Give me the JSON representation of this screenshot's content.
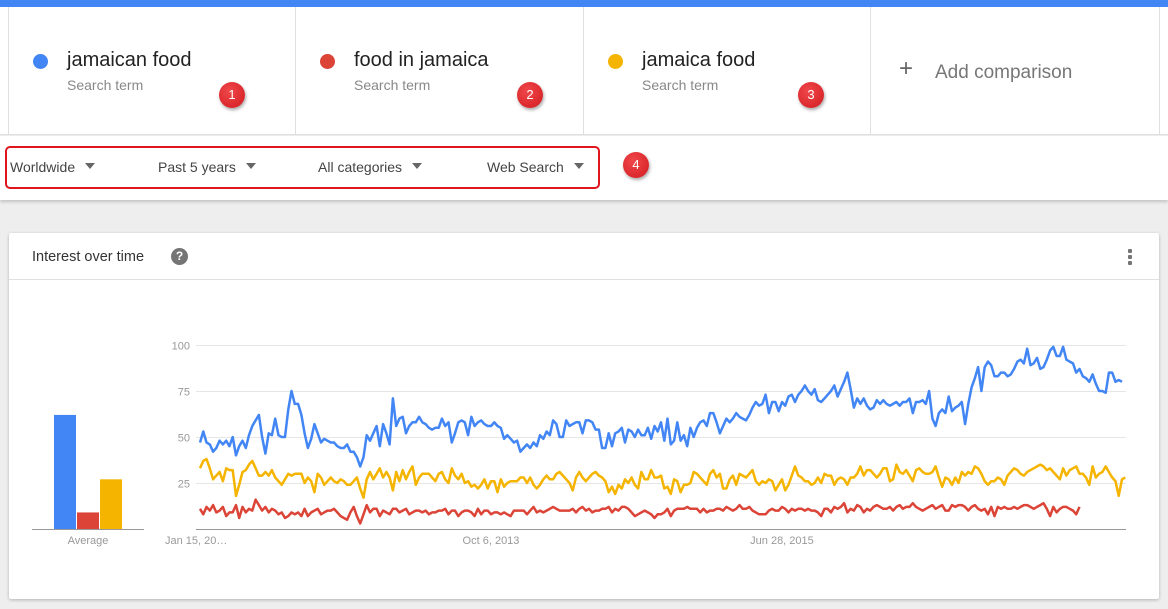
{
  "header": {
    "accent_color": "#4285f4"
  },
  "terms": [
    {
      "name": "jamaican food",
      "type": "Search term",
      "color": "#4285f4",
      "badge": "1"
    },
    {
      "name": "food in jamaica",
      "type": "Search term",
      "color": "#db4437",
      "badge": "2"
    },
    {
      "name": "jamaica food",
      "type": "Search term",
      "color": "#f4b400",
      "badge": "3"
    }
  ],
  "add_comparison": {
    "icon": "plus-icon",
    "label": "Add comparison"
  },
  "filters": {
    "items": [
      {
        "label": "Worldwide"
      },
      {
        "label": "Past 5 years"
      },
      {
        "label": "All categories"
      },
      {
        "label": "Web Search"
      }
    ],
    "badge": "4"
  },
  "card": {
    "title": "Interest over time",
    "help_icon": "?",
    "menu_icon": "more-vert-icon"
  },
  "chart_data": [
    {
      "type": "bar",
      "title": "Average",
      "categories": [
        "jamaican food",
        "food in jamaica",
        "jamaica food"
      ],
      "values": [
        62,
        9,
        27
      ],
      "colors": [
        "#4285f4",
        "#db4437",
        "#f4b400"
      ],
      "xlabel": "Average",
      "ylim": [
        0,
        100
      ]
    },
    {
      "type": "line",
      "title": "Interest over time",
      "x_tick_labels": [
        "Jan 15, 20…",
        "Oct 6, 2013",
        "Jun 28, 2015"
      ],
      "x_tick_index": [
        0,
        89,
        178
      ],
      "y_ticks": [
        25,
        50,
        75,
        100
      ],
      "ylim": [
        0,
        100
      ],
      "grid": true,
      "legend": "none",
      "series": [
        {
          "name": "jamaican food",
          "color": "#4285f4",
          "values": [
            47,
            53,
            47,
            46,
            42,
            44,
            48,
            46,
            48,
            45,
            50,
            40,
            45,
            48,
            44,
            51,
            56,
            59,
            62,
            50,
            41,
            52,
            51,
            60,
            51,
            50,
            50,
            65,
            75,
            68,
            68,
            62,
            52,
            44,
            49,
            57,
            52,
            47,
            49,
            48,
            47,
            47,
            45,
            44,
            44,
            46,
            42,
            42,
            39,
            34,
            39,
            51,
            48,
            52,
            56,
            45,
            57,
            52,
            46,
            71,
            56,
            60,
            61,
            52,
            56,
            58,
            58,
            61,
            58,
            57,
            55,
            54,
            55,
            55,
            60,
            56,
            58,
            47,
            52,
            58,
            59,
            58,
            51,
            61,
            56,
            58,
            59,
            57,
            56,
            56,
            58,
            56,
            55,
            49,
            51,
            49,
            47,
            48,
            42,
            44,
            46,
            44,
            47,
            45,
            51,
            49,
            53,
            51,
            59,
            57,
            50,
            50,
            59,
            56,
            57,
            58,
            58,
            52,
            59,
            59,
            58,
            54,
            54,
            44,
            44,
            52,
            45,
            52,
            53,
            55,
            47,
            54,
            53,
            50,
            54,
            51,
            51,
            55,
            49,
            56,
            53,
            58,
            48,
            60,
            46,
            48,
            58,
            48,
            51,
            45,
            55,
            50,
            55,
            58,
            59,
            56,
            63,
            63,
            58,
            52,
            56,
            60,
            58,
            60,
            63,
            61,
            60,
            59,
            62,
            66,
            69,
            67,
            68,
            73,
            63,
            69,
            69,
            64,
            69,
            67,
            72,
            73,
            69,
            73,
            75,
            78,
            75,
            73,
            76,
            70,
            69,
            71,
            73,
            75,
            78,
            72,
            76,
            80,
            85,
            76,
            66,
            71,
            68,
            71,
            67,
            65,
            66,
            70,
            68,
            70,
            68,
            67,
            68,
            69,
            67,
            69,
            69,
            71,
            63,
            69,
            69,
            70,
            68,
            75,
            60,
            56,
            63,
            65,
            63,
            72,
            64,
            66,
            67,
            69,
            57,
            68,
            77,
            82,
            88,
            75,
            88,
            91,
            89,
            83,
            83,
            85,
            85,
            83,
            84,
            87,
            91,
            92,
            90,
            98,
            89,
            90,
            93,
            87,
            88,
            92,
            97,
            99,
            94,
            94,
            99,
            92,
            91,
            90,
            85,
            87,
            83,
            82,
            80,
            84,
            79,
            75,
            75,
            74,
            85,
            85,
            80,
            81,
            80
          ]
        },
        {
          "name": "food in jamaica",
          "color": "#db4437",
          "values": [
            11,
            8,
            12,
            10,
            13,
            9,
            10,
            12,
            7,
            9,
            9,
            13,
            6,
            12,
            9,
            11,
            10,
            16,
            13,
            10,
            12,
            9,
            11,
            10,
            8,
            9,
            6,
            7,
            9,
            8,
            9,
            7,
            11,
            7,
            9,
            10,
            11,
            8,
            9,
            10,
            10,
            11,
            9,
            7,
            6,
            5,
            9,
            12,
            7,
            3,
            8,
            13,
            9,
            11,
            11,
            7,
            10,
            9,
            8,
            11,
            11,
            9,
            10,
            11,
            8,
            9,
            10,
            10,
            9,
            10,
            8,
            9,
            9,
            10,
            10,
            11,
            8,
            10,
            10,
            7,
            9,
            10,
            10,
            9,
            7,
            11,
            8,
            10,
            10,
            8,
            9,
            9,
            8,
            9,
            8,
            7,
            10,
            10,
            10,
            10,
            8,
            10,
            12,
            9,
            10,
            9,
            10,
            11,
            12,
            11,
            10,
            10,
            10,
            10,
            11,
            9,
            11,
            12,
            10,
            11,
            9,
            10,
            10,
            11,
            11,
            12,
            9,
            11,
            10,
            12,
            12,
            11,
            9,
            7,
            8,
            9,
            10,
            9,
            8,
            6,
            8,
            8,
            9,
            11,
            7,
            10,
            11,
            11,
            11,
            12,
            11,
            11,
            11,
            9,
            11,
            9,
            10,
            10,
            11,
            11,
            10,
            12,
            11,
            10,
            11,
            13,
            11,
            11,
            12,
            10,
            9,
            8,
            8,
            8,
            10,
            11,
            10,
            10,
            12,
            11,
            9,
            11,
            10,
            11,
            11,
            10,
            11,
            10,
            10,
            9,
            7,
            11,
            11,
            9,
            12,
            11,
            12,
            14,
            9,
            11,
            10,
            13,
            12,
            9,
            11,
            10,
            12,
            13,
            12,
            11,
            11,
            12,
            10,
            12,
            13,
            11,
            12,
            12,
            14,
            12,
            11,
            10,
            11,
            12,
            13,
            11,
            12,
            13,
            10,
            10,
            13,
            12,
            13,
            13,
            12,
            10,
            12,
            13,
            11,
            10,
            11,
            8,
            12,
            7,
            12,
            11,
            12,
            11,
            11,
            12,
            11,
            12,
            13,
            13,
            12,
            11,
            12,
            13,
            14,
            11,
            7,
            12,
            9,
            11,
            12,
            12,
            11,
            10,
            8,
            12
          ]
        },
        {
          "name": "jamaica food",
          "color": "#f4b400",
          "values": [
            33,
            37,
            38,
            33,
            27,
            29,
            31,
            26,
            33,
            32,
            32,
            18,
            24,
            31,
            32,
            35,
            37,
            33,
            29,
            29,
            31,
            29,
            32,
            28,
            26,
            24,
            27,
            30,
            29,
            30,
            30,
            30,
            25,
            28,
            26,
            20,
            30,
            28,
            24,
            26,
            28,
            26,
            25,
            27,
            26,
            24,
            24,
            26,
            28,
            22,
            17,
            27,
            31,
            27,
            30,
            33,
            28,
            31,
            28,
            21,
            31,
            26,
            32,
            27,
            31,
            34,
            24,
            28,
            30,
            30,
            30,
            28,
            26,
            30,
            31,
            27,
            25,
            33,
            29,
            27,
            30,
            25,
            26,
            23,
            24,
            22,
            24,
            27,
            22,
            26,
            26,
            20,
            27,
            23,
            25,
            26,
            26,
            26,
            28,
            28,
            25,
            28,
            24,
            22,
            24,
            27,
            29,
            27,
            27,
            30,
            31,
            29,
            27,
            25,
            21,
            28,
            31,
            28,
            26,
            28,
            30,
            31,
            29,
            28,
            26,
            20,
            23,
            19,
            24,
            22,
            27,
            25,
            28,
            24,
            22,
            31,
            27,
            27,
            32,
            28,
            28,
            29,
            22,
            23,
            19,
            27,
            26,
            20,
            24,
            24,
            25,
            31,
            30,
            28,
            26,
            24,
            30,
            32,
            28,
            30,
            22,
            22,
            27,
            29,
            24,
            30,
            29,
            28,
            30,
            32,
            26,
            24,
            26,
            25,
            27,
            26,
            21,
            24,
            27,
            21,
            24,
            29,
            34,
            29,
            28,
            26,
            26,
            24,
            25,
            28,
            25,
            30,
            29,
            29,
            24,
            27,
            28,
            27,
            24,
            28,
            28,
            30,
            34,
            29,
            32,
            32,
            30,
            28,
            30,
            33,
            33,
            26,
            27,
            35,
            31,
            30,
            32,
            29,
            26,
            32,
            33,
            31,
            30,
            30,
            31,
            34,
            28,
            23,
            28,
            27,
            24,
            28,
            25,
            31,
            29,
            31,
            30,
            34,
            33,
            30,
            26,
            24,
            26,
            26,
            28,
            27,
            24,
            29,
            31,
            33,
            32,
            30,
            29,
            31,
            32,
            33,
            34,
            35,
            34,
            32,
            33,
            31,
            29,
            27,
            33,
            29,
            32,
            33,
            34,
            30,
            30,
            28,
            24,
            34,
            28,
            30,
            31,
            34,
            31,
            28,
            26,
            18,
            27,
            28
          ]
        }
      ]
    }
  ]
}
